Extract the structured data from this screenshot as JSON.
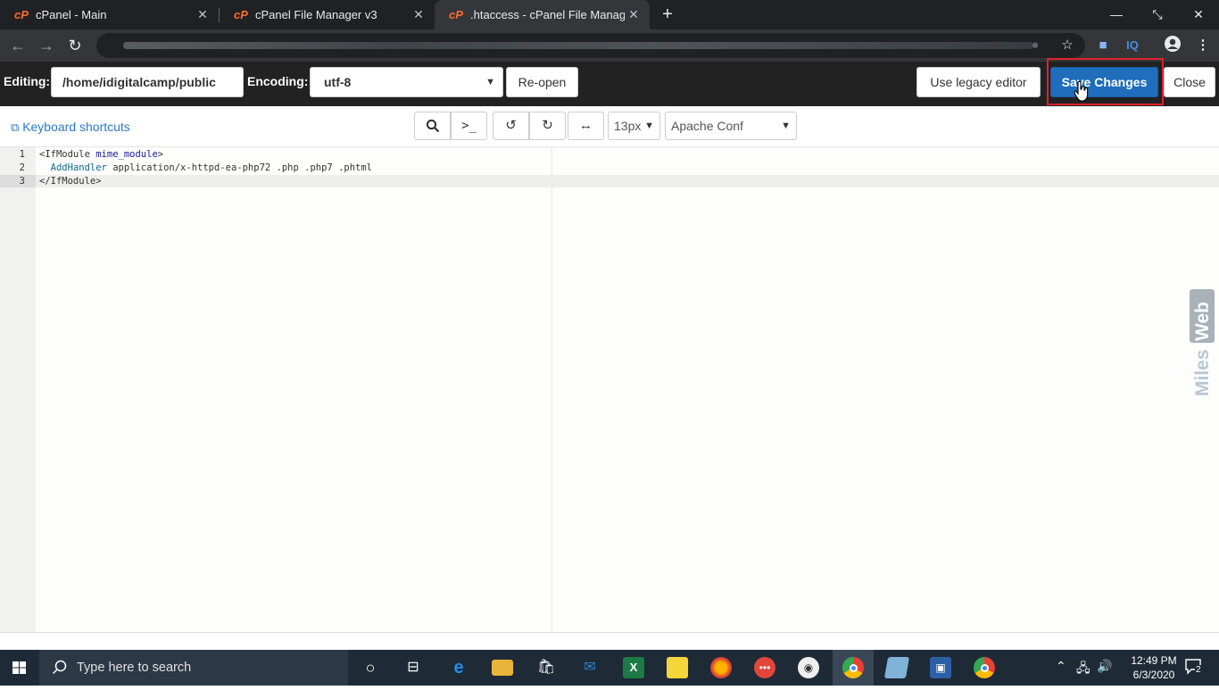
{
  "browser": {
    "tabs": [
      {
        "title": "cPanel - Main",
        "favicon": "cpanel-icon"
      },
      {
        "title": "cPanel File Manager v3",
        "favicon": "cpanel-icon"
      },
      {
        "title": ".htaccess - cPanel File Manager v",
        "favicon": "cpanel-icon",
        "active": true
      }
    ],
    "new_tab": "+",
    "window_controls": {
      "minimize": "—",
      "restore": "⤡",
      "close": "✕"
    }
  },
  "editor_header": {
    "editing_label": "Editing:",
    "path_value": "/home/idigitalcamp/public",
    "encoding_label": "Encoding:",
    "encoding_value": "utf-8",
    "reopen_label": "Re-open",
    "legacy_label": "Use legacy editor",
    "save_label": "Save Changes",
    "close_label": "Close"
  },
  "editor_toolbar": {
    "shortcuts_label": "Keyboard shortcuts",
    "font_size": "13px",
    "mode": "Apache Conf"
  },
  "code": {
    "line_numbers": [
      "1",
      "2",
      "3"
    ],
    "lines": [
      {
        "tag": "<IfModule",
        "arg": "mime_module",
        "end": ">"
      },
      {
        "directive": "AddHandler",
        "rest": "application/x-httpd-ea-php72 .php .php7 .phtml"
      },
      {
        "tag": "</IfModule>"
      }
    ]
  },
  "watermark": "MilesWeb",
  "taskbar": {
    "search_placeholder": "Type here to search",
    "time": "12:49 PM",
    "date": "6/3/2020",
    "notification_count": "2"
  },
  "colors": {
    "save_button": "#1f6dbb",
    "highlight_border": "#e0202a",
    "header_bg": "#222222",
    "link": "#2c7bc4"
  }
}
